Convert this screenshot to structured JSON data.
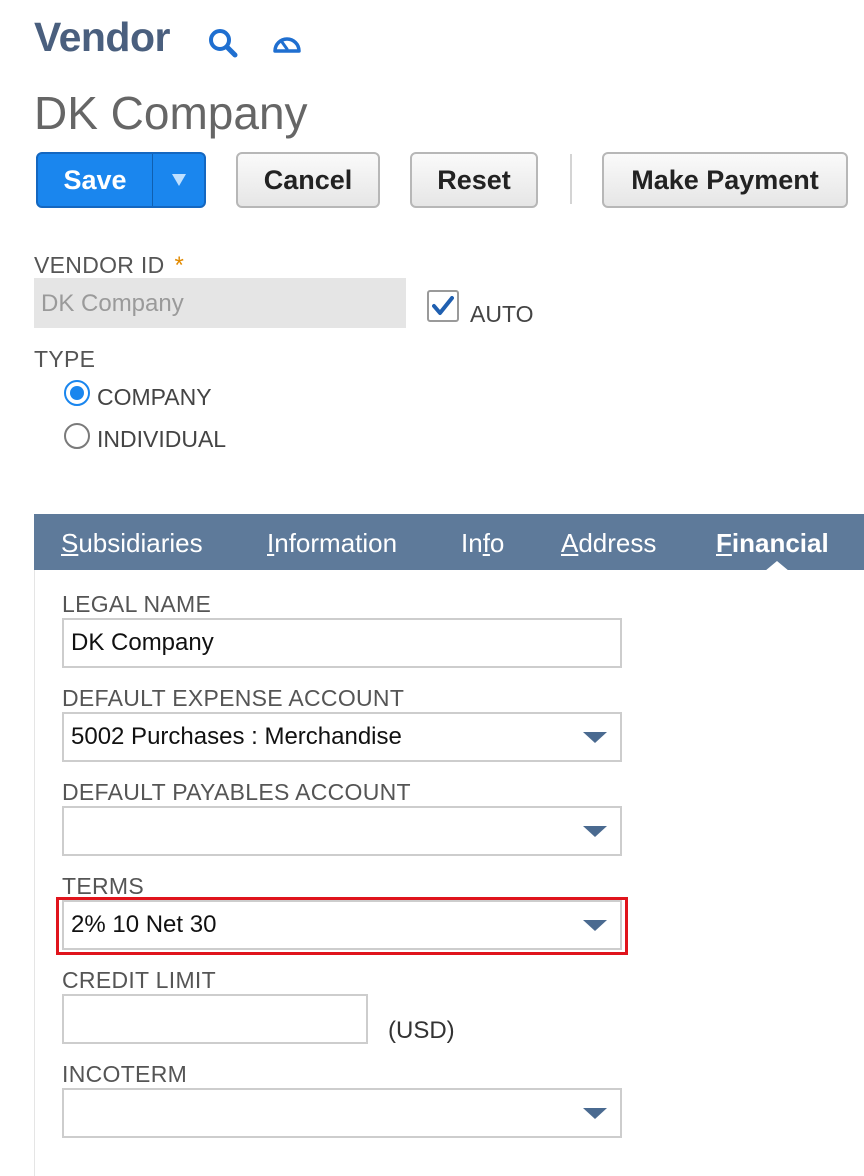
{
  "header": {
    "record_type": "Vendor",
    "record_name": "DK Company",
    "icons": [
      "search-icon",
      "dashboard-icon"
    ]
  },
  "toolbar": {
    "save_label": "Save",
    "cancel_label": "Cancel",
    "reset_label": "Reset",
    "make_payment_label": "Make Payment"
  },
  "primary": {
    "vendor_id_label": "VENDOR ID",
    "required_mark": "*",
    "vendor_id_value": "DK Company",
    "auto_label": "AUTO",
    "auto_checked": true,
    "type_label": "TYPE",
    "type_options": [
      {
        "label": "COMPANY",
        "selected": true
      },
      {
        "label": "INDIVIDUAL",
        "selected": false
      }
    ]
  },
  "tabs": [
    {
      "accel": "S",
      "rest": "ubsidiaries",
      "active": false
    },
    {
      "accel": "I",
      "rest": "nformation",
      "active": false
    },
    {
      "accel": "",
      "pre": "In",
      "accel2": "f",
      "rest": "o",
      "active": false
    },
    {
      "accel": "A",
      "rest": "ddress",
      "active": false
    },
    {
      "accel": "F",
      "rest": "inancial",
      "active": true
    }
  ],
  "financial": {
    "legal_name_label": "LEGAL NAME",
    "legal_name_value": "DK Company",
    "expense_account_label": "DEFAULT EXPENSE ACCOUNT",
    "expense_account_value": "5002 Purchases : Merchandise",
    "payables_account_label": "DEFAULT PAYABLES ACCOUNT",
    "payables_account_value": "",
    "terms_label": "TERMS",
    "terms_value": "2% 10 Net 30",
    "credit_limit_label": "CREDIT LIMIT",
    "credit_limit_value": "",
    "currency_label": "(USD)",
    "incoterm_label": "INCOTERM",
    "incoterm_value": ""
  },
  "colors": {
    "accent": "#1a86ee",
    "title": "#4a5f7e",
    "tabbar": "#5e7a9a",
    "highlight": "#e0141c",
    "required": "#e28a00"
  }
}
